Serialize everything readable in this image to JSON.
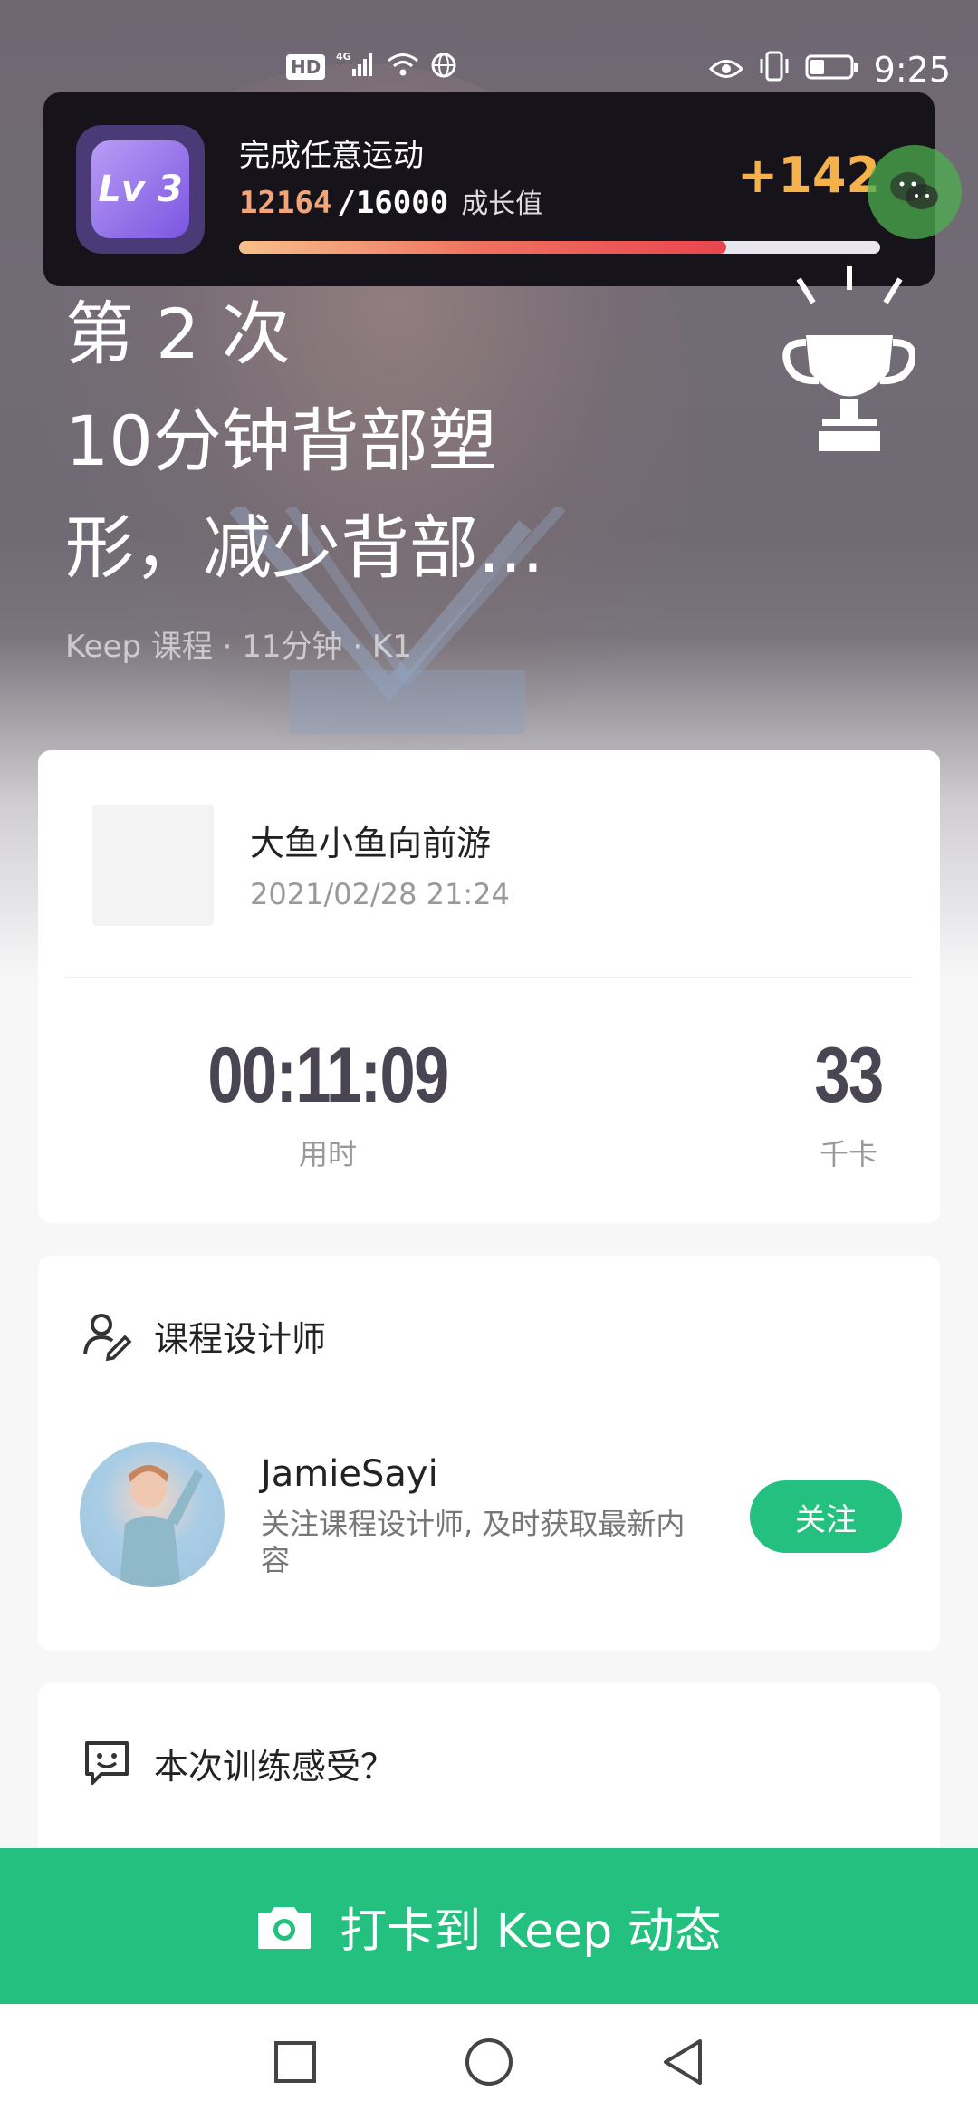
{
  "status_bar": {
    "left_icons": [
      "hd-icon",
      "4g-signal-icon",
      "wifi-icon",
      "vpn-globe-icon"
    ],
    "hd_label": "HD",
    "network_label": "4G",
    "right_icons": [
      "eye-comfort-icon",
      "vibrate-icon",
      "battery-icon"
    ],
    "time": "9:25",
    "battery_level": 0.35
  },
  "achievement_toast": {
    "level_badge": "Lv 3",
    "title": "完成任意运动",
    "current_value": "12164",
    "total_value": "/16000",
    "value_label": "成长值",
    "progress": 0.76,
    "points_gained": "+142",
    "colors": {
      "points": "#f6b24a",
      "current": "#f3a57a"
    }
  },
  "peek_text": "完",
  "hero": {
    "count_line": "第 2 次",
    "title": "10分钟背部塑形，减少背部...",
    "subtitle": "Keep 课程 · 11分钟 · K1"
  },
  "workout_card": {
    "user_name": "大鱼小鱼向前游",
    "datetime": "2021/02/28 21:24",
    "stats": [
      {
        "value": "00:11:09",
        "label": "用时"
      },
      {
        "value": "33",
        "label": "千卡"
      }
    ]
  },
  "designer_card": {
    "section_title": "课程设计师",
    "name": "JamieSayi",
    "description": "关注课程设计师, 及时获取最新内容",
    "follow_label": "关注"
  },
  "feedback_card": {
    "section_title": "本次训练感受？"
  },
  "cta": {
    "label": "打卡到 Keep 动态",
    "color": "#24c07f"
  },
  "nav_bar": {
    "buttons": [
      "recents-square-icon",
      "home-circle-icon",
      "back-triangle-icon"
    ]
  }
}
